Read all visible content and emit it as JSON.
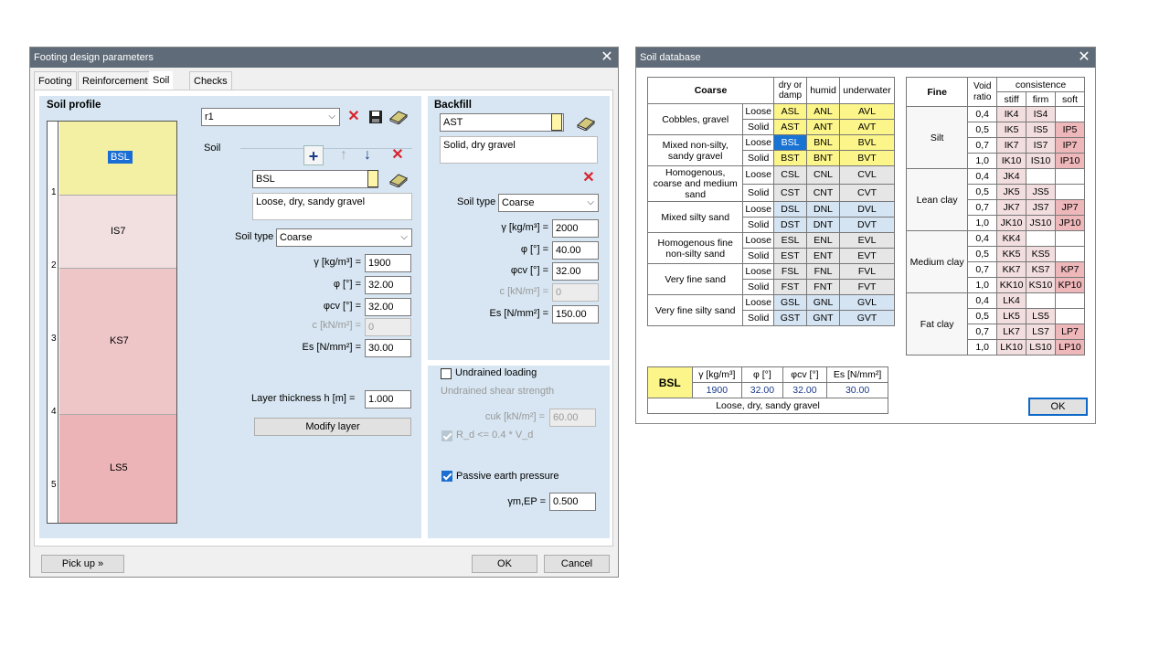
{
  "left_window": {
    "title": "Footing design parameters",
    "tabs": [
      "Footing",
      "Reinforcement",
      "Soil",
      "Checks"
    ],
    "soil_profile": {
      "title": "Soil profile",
      "ruler": [
        "1",
        "2",
        "3",
        "4",
        "5"
      ],
      "layers": [
        {
          "code": "BSL",
          "color": "#f3f0a4"
        },
        {
          "code": "IS7",
          "color": "#f2dfe0"
        },
        {
          "code": "KS7",
          "color": "#efc6c8"
        },
        {
          "code": "LS5",
          "color": "#ecb4b6"
        }
      ]
    },
    "profile_select": "r1",
    "soil": {
      "label": "Soil",
      "code": "BSL",
      "description": "Loose, dry, sandy gravel",
      "soil_type_label": "Soil type",
      "soil_type": "Coarse",
      "gamma_label": "γ [kg/m³] =",
      "gamma": "1900",
      "phi_label": "φ [°] =",
      "phi": "32.00",
      "phicv_label": "φcv [°] =",
      "phicv": "32.00",
      "c_label": "c [kN/m²] =",
      "c": "0",
      "es_label": "Es [N/mm²] =",
      "es": "30.00",
      "thickness_label": "Layer thickness    h [m] =",
      "thickness": "1.000",
      "modify_button": "Modify layer"
    },
    "backfill": {
      "title": "Backfill",
      "code": "AST",
      "description": "Solid, dry gravel",
      "soil_type_label": "Soil type",
      "soil_type": "Coarse",
      "gamma_label": "γ [kg/m³] =",
      "gamma": "2000",
      "phi_label": "φ [°] =",
      "phi": "40.00",
      "phicv_label": "φcv [°] =",
      "phicv": "32.00",
      "c_label": "c [kN/m²] =",
      "c": "0",
      "es_label": "Es [N/mm²] =",
      "es": "150.00"
    },
    "undrained": {
      "checkbox_label": "Undrained loading",
      "shear_strength_label": "Undrained shear strength",
      "cuk_label": "cuk [kN/m²] =",
      "cuk": "60.00",
      "rd_label": "R_d <= 0.4 * V_d"
    },
    "passive": {
      "checkbox_label": "Passive earth pressure",
      "gamma_label": "γm,EP =",
      "gamma": "0.500"
    },
    "buttons": {
      "pickup": "Pick up »",
      "ok": "OK",
      "cancel": "Cancel"
    }
  },
  "right_window": {
    "title": "Soil database",
    "coarse_table": {
      "headers": [
        "Coarse",
        "dry or damp",
        "humid",
        "underwater"
      ],
      "groups": [
        {
          "name": "Cobbles, gravel",
          "rows": [
            [
              "Loose",
              "ASL",
              "ANL",
              "AVL"
            ],
            [
              "Solid",
              "AST",
              "ANT",
              "AVT"
            ]
          ],
          "cls": "y"
        },
        {
          "name": "Mixed non-silty, sandy gravel",
          "rows": [
            [
              "Loose",
              "BSL",
              "BNL",
              "BVL"
            ],
            [
              "Solid",
              "BST",
              "BNT",
              "BVT"
            ]
          ],
          "cls": "y"
        },
        {
          "name": "Homogenous, coarse and medium sand",
          "rows": [
            [
              "Loose",
              "CSL",
              "CNL",
              "CVL"
            ],
            [
              "Solid",
              "CST",
              "CNT",
              "CVT"
            ]
          ],
          "cls": "bl"
        },
        {
          "name": "Mixed silty sand",
          "rows": [
            [
              "Loose",
              "DSL",
              "DNL",
              "DVL"
            ],
            [
              "Solid",
              "DST",
              "DNT",
              "DVT"
            ]
          ],
          "cls": "bs"
        },
        {
          "name": "Homogenous fine non-silty sand",
          "rows": [
            [
              "Loose",
              "ESL",
              "ENL",
              "EVL"
            ],
            [
              "Solid",
              "EST",
              "ENT",
              "EVT"
            ]
          ],
          "cls": "bl"
        },
        {
          "name": "Very fine sand",
          "rows": [
            [
              "Loose",
              "FSL",
              "FNL",
              "FVL"
            ],
            [
              "Solid",
              "FST",
              "FNT",
              "FVT"
            ]
          ],
          "cls": "bl"
        },
        {
          "name": "Very fine silty sand",
          "rows": [
            [
              "Loose",
              "GSL",
              "GNL",
              "GVL"
            ],
            [
              "Solid",
              "GST",
              "GNT",
              "GVT"
            ]
          ],
          "cls": "bs"
        }
      ]
    },
    "fine_table": {
      "headers": [
        "Fine",
        "Void ratio",
        "consistence",
        "stiff",
        "firm",
        "soft"
      ],
      "groups": [
        {
          "name": "Silt",
          "rows": [
            [
              "0,4",
              "IK4",
              "IS4",
              ""
            ],
            [
              "0,5",
              "IK5",
              "IS5",
              "IP5"
            ],
            [
              "0,7",
              "IK7",
              "IS7",
              "IP7"
            ],
            [
              "1,0",
              "IK10",
              "IS10",
              "IP10"
            ]
          ]
        },
        {
          "name": "Lean clay",
          "rows": [
            [
              "0,4",
              "JK4",
              "",
              ""
            ],
            [
              "0,5",
              "JK5",
              "JS5",
              ""
            ],
            [
              "0,7",
              "JK7",
              "JS7",
              "JP7"
            ],
            [
              "1,0",
              "JK10",
              "JS10",
              "JP10"
            ]
          ]
        },
        {
          "name": "Medium clay",
          "rows": [
            [
              "0,4",
              "KK4",
              "",
              ""
            ],
            [
              "0,5",
              "KK5",
              "KS5",
              ""
            ],
            [
              "0,7",
              "KK7",
              "KS7",
              "KP7"
            ],
            [
              "1,0",
              "KK10",
              "KS10",
              "KP10"
            ]
          ]
        },
        {
          "name": "Fat clay",
          "rows": [
            [
              "0,4",
              "LK4",
              "",
              ""
            ],
            [
              "0,5",
              "LK5",
              "LS5",
              ""
            ],
            [
              "0,7",
              "LK7",
              "LS7",
              "LP7"
            ],
            [
              "1,0",
              "LK10",
              "LS10",
              "LP10"
            ]
          ]
        }
      ]
    },
    "summary": {
      "code": "BSL",
      "headers": [
        "γ [kg/m³]",
        "φ [°]",
        "φcv [°]",
        "Es [N/mm²]"
      ],
      "values": [
        "1900",
        "32.00",
        "32.00",
        "30.00"
      ],
      "description": "Loose, dry, sandy gravel"
    },
    "ok_button": "OK"
  }
}
